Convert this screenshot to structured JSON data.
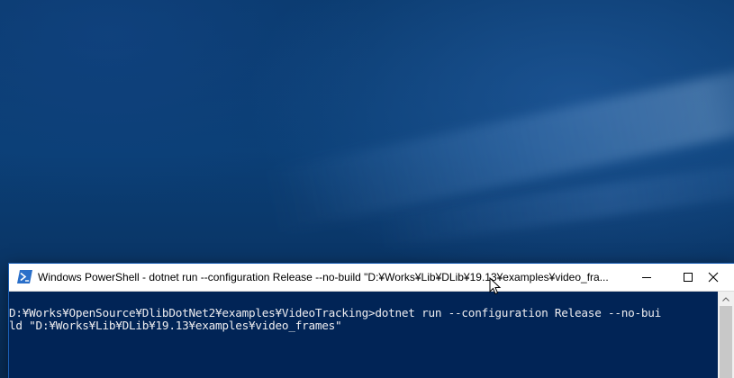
{
  "window": {
    "title": "Windows PowerShell - dotnet  run --configuration Release --no-build \"D:¥Works¥Lib¥DLib¥19.13¥examples¥video_fra..."
  },
  "console": {
    "lines": [
      "D:¥Works¥OpenSource¥DlibDotNet2¥examples¥VideoTracking>dotnet run --configuration Release --no-bui",
      "ld \"D:¥Works¥Lib¥DLib¥19.13¥examples¥video_frames\""
    ]
  },
  "icons": {
    "app": "powershell-icon",
    "minimize": "minimize-icon",
    "maximize": "maximize-icon",
    "close": "close-icon",
    "cursor": "mouse-pointer-icon"
  },
  "colors": {
    "console_background": "#012456",
    "console_text": "#eeedf0",
    "titlebar": "#ffffff"
  }
}
